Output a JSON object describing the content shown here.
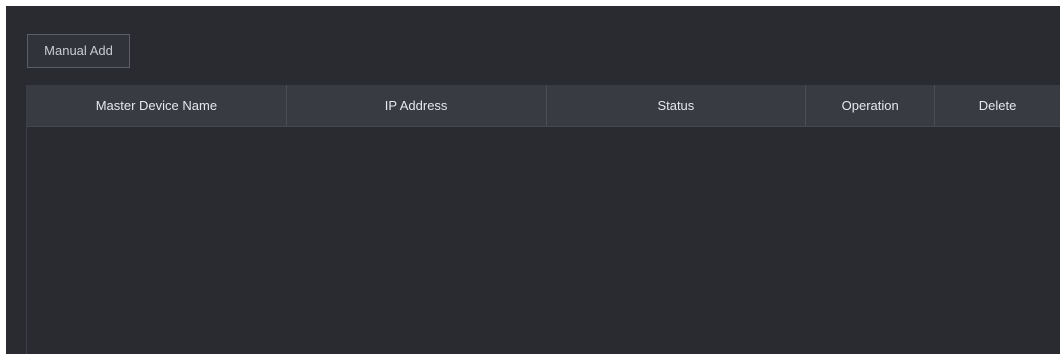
{
  "toolbar": {
    "manual_add_label": "Manual Add"
  },
  "table": {
    "columns": [
      "Master Device Name",
      "IP Address",
      "Status",
      "Operation",
      "Delete"
    ],
    "rows": []
  },
  "colors": {
    "background": "#292b31",
    "header": "#383b42",
    "text": "#e6e7ea"
  }
}
